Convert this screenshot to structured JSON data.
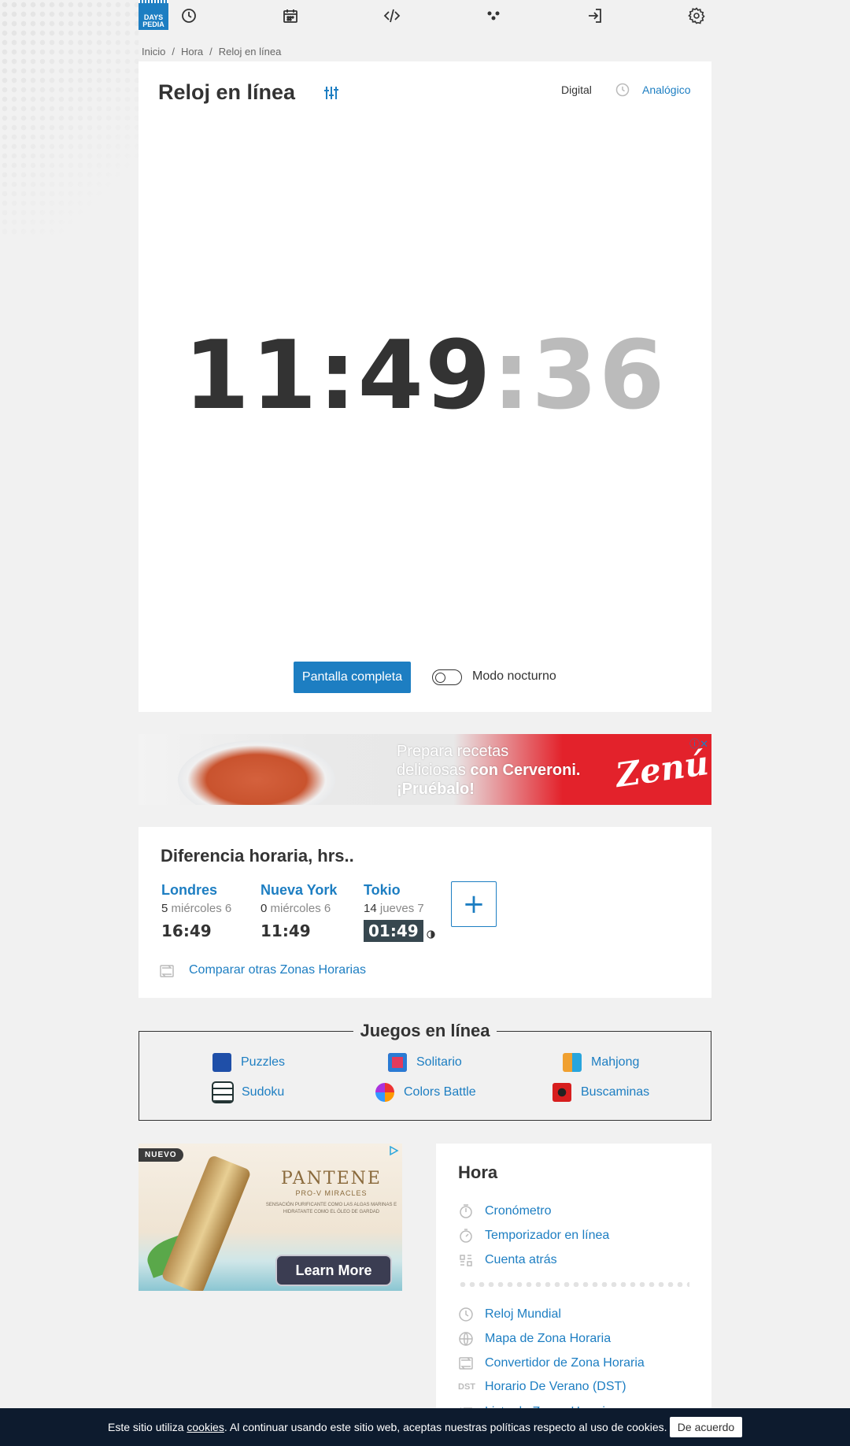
{
  "brand": {
    "logo_line1": "DAYS",
    "logo_line2": "PEDIA"
  },
  "nav": {
    "icons": [
      "clock-icon",
      "calendar-icon",
      "code-icon",
      "games-icon",
      "login-icon",
      "gear-icon"
    ]
  },
  "breadcrumb": [
    "Inicio",
    "Hora",
    "Reloj en línea"
  ],
  "clock": {
    "title": "Reloj en línea",
    "mode_digital": "Digital",
    "mode_analog": "Analógico",
    "hours_minutes": "11:49",
    "seconds": ":36",
    "fullscreen_label": "Pantalla completa",
    "night_mode_label": "Modo nocturno",
    "night_mode_on": false
  },
  "ad1": {
    "line1": "Prepara recetas",
    "line2_a": "deliciosas ",
    "line2_b": "con Cerveroni.",
    "line3": "¡Pruébalo!",
    "brand": "Zenú",
    "colors": {
      "brand_red": "#e3222b"
    }
  },
  "timediff": {
    "title": "Diferencia horaria, hrs..",
    "cities": [
      {
        "name": "Londres",
        "diff": "5",
        "day": "miércoles 6",
        "time": "16:49",
        "night": false
      },
      {
        "name": "Nueva York",
        "diff": "0",
        "day": "miércoles 6",
        "time": "11:49",
        "night": false
      },
      {
        "name": "Tokio",
        "diff": "14",
        "day": "jueves 7",
        "time": "01:49",
        "night": true
      }
    ],
    "add_label": "+",
    "compare_label": "Comparar otras Zonas Horarias"
  },
  "games": {
    "title": "Juegos en línea",
    "items": [
      {
        "label": "Puzzles",
        "icon": "puzzles-icon"
      },
      {
        "label": "Solitario",
        "icon": "solitaire-icon"
      },
      {
        "label": "Mahjong",
        "icon": "mahjong-icon"
      },
      {
        "label": "Sudoku",
        "icon": "sudoku-icon"
      },
      {
        "label": "Colors Battle",
        "icon": "colors-battle-icon"
      },
      {
        "label": "Buscaminas",
        "icon": "minesweeper-icon"
      }
    ]
  },
  "ad2": {
    "badge": "NUEVO",
    "brand": "PANTENE",
    "sub": "PRO-V MIRACLES",
    "tagline": "SENSACIÓN PURIFICANTE COMO LAS ALGAS MARINAS E HIDRATANTE COMO EL ÓLEO DE GARDAD",
    "cta": "Learn More"
  },
  "hora": {
    "title": "Hora",
    "links_top": [
      {
        "label": "Cronómetro",
        "icon": "stopwatch-icon"
      },
      {
        "label": "Temporizador en línea",
        "icon": "timer-icon"
      },
      {
        "label": "Cuenta atrás",
        "icon": "countdown-icon"
      }
    ],
    "links_bottom": [
      {
        "label": "Reloj Mundial",
        "icon": "world-clock-icon"
      },
      {
        "label": "Mapa de Zona Horaria",
        "icon": "globe-icon"
      },
      {
        "label": "Convertidor de Zona Horaria",
        "icon": "convert-icon"
      },
      {
        "label": "Horario De Verano (DST)",
        "icon": "dst-icon",
        "icon_text": "DST"
      },
      {
        "label": "Lista de Zonas Horarias",
        "icon": "list-icon"
      }
    ]
  },
  "cookies": {
    "text_before": "Este sitio utiliza ",
    "link": "cookies",
    "text_after": ". Al continuar usando este sitio web, aceptas nuestras políticas respecto al uso de cookies.",
    "button": "De acuerdo"
  },
  "colors": {
    "accent": "#1d7ec2",
    "text": "#333333",
    "cookie_bg": "#0d1b2e"
  }
}
